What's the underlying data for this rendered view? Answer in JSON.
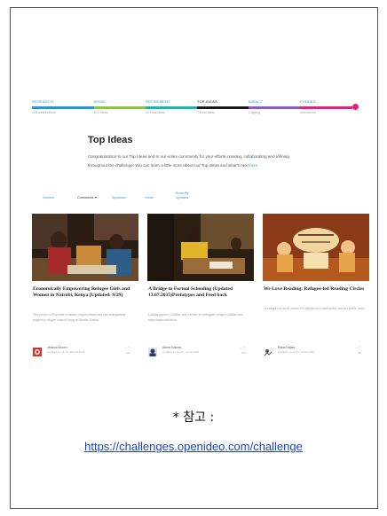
{
  "phases": [
    {
      "label": "RESEARCH",
      "sub": "448 contributions",
      "color": "#2196d9",
      "label_color": "#2196d9"
    },
    {
      "label": "IDEAS",
      "sub": "572 Ideas",
      "color": "#8cc63f",
      "label_color": "#2196d9"
    },
    {
      "label": "REFINEMENT",
      "sub": "20 Final Ideas",
      "color": "#15b7b0",
      "label_color": "#2196d9"
    },
    {
      "label": "TOP IDEAS",
      "sub": "7 Final Ideas",
      "color": "#1a1a1a",
      "label_color": "#1a1a1a"
    },
    {
      "label": "IMPACT",
      "sub": "Ongoing",
      "color": "#8b5cc8",
      "label_color": "#2196d9"
    },
    {
      "label": "FUNDED",
      "sub": "Announced",
      "color": "#e81e7a",
      "label_color": "#2196d9"
    }
  ],
  "page_title": "Top Ideas",
  "intro_text": "Congratulations to our Top Ideas and to our entire community for your efforts creating, collaborating and refining throughout the challenge! You can learn a little more about our Top Ideas and what's next ",
  "intro_link": "here",
  "filters": {
    "newest": "Newest",
    "comments": "Comments",
    "applause": "Applause",
    "views": "Views",
    "recently_updated": "Recently updated"
  },
  "cards": [
    {
      "title": "Economically Empowering Refugee Girls and Women in Nairobi, Kenya [Updated: 9/29]",
      "desc": "This project will provide economic empowerment and case management support to refugee women living in Nairobi, Kenya.",
      "author": "Jessica Brown",
      "updated": "Updated on 11:18, Mar 29 2015",
      "count": "347",
      "avatar_color": "#d8342b"
    },
    {
      "title": "A Bridge to Formal Schooling (Updated 13.07.2015)Prototypes and Feed back",
      "desc": "Linking parents, children, and teachers to reintegrate refugee children into mainstream education.",
      "author": "Albert Sakina",
      "updated": "Updated on 07:12, Jul 22 2015",
      "count": "146",
      "avatar_color": "#2a3a6a"
    },
    {
      "title": "We Love Reading: Refugee-led Reading Circles",
      "desc": "Creating local small centres for children in a comfortable area in a public space.",
      "author": "Rana Dajani",
      "updated": "Updated on 12:33, Jul 23 2015",
      "count": "88",
      "avatar_color": "#555555"
    }
  ],
  "note": "* 참고 :",
  "source_url": "https://challenges.openideo.com/challenge"
}
